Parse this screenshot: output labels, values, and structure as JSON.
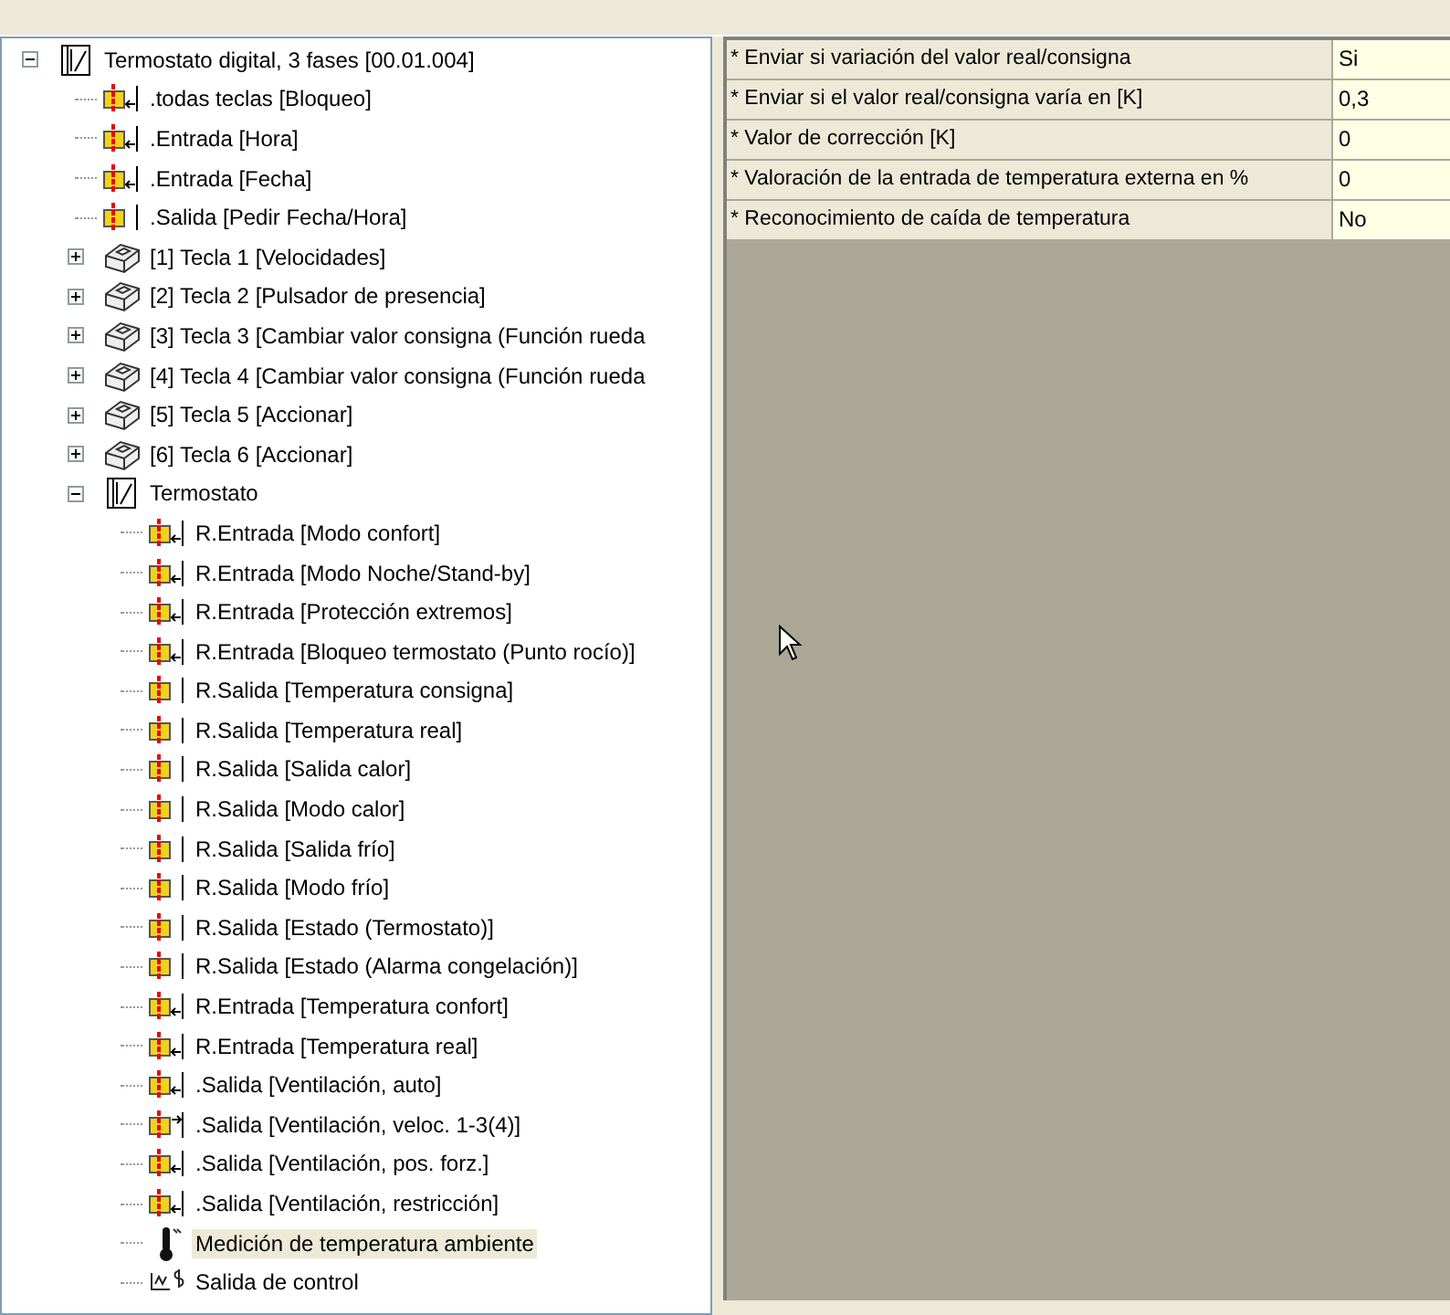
{
  "tree": [
    {
      "label": "Termostato digital, 3 fases [00.01.004]",
      "kind": "function-block",
      "expanded": true,
      "selected": false,
      "children": [
        {
          "label": ".todas teclas [Bloqueo]",
          "kind": "comm-in",
          "selected": false
        },
        {
          "label": ".Entrada [Hora]",
          "kind": "comm-in",
          "selected": false
        },
        {
          "label": ".Entrada [Fecha]",
          "kind": "comm-in",
          "selected": false
        },
        {
          "label": ".Salida [Pedir Fecha/Hora]",
          "kind": "comm-out",
          "selected": false
        },
        {
          "label": "[1] Tecla 1 [Velocidades]",
          "kind": "key-module",
          "expanded": false,
          "selected": false
        },
        {
          "label": "[2] Tecla 2 [Pulsador de presencia]",
          "kind": "key-module",
          "expanded": false,
          "selected": false
        },
        {
          "label": "[3] Tecla 3 [Cambiar valor consigna (Función rueda",
          "kind": "key-module",
          "expanded": false,
          "selected": false
        },
        {
          "label": "[4] Tecla 4 [Cambiar valor consigna (Función rueda",
          "kind": "key-module",
          "expanded": false,
          "selected": false
        },
        {
          "label": "[5] Tecla 5 [Accionar]",
          "kind": "key-module",
          "expanded": false,
          "selected": false
        },
        {
          "label": "[6] Tecla 6 [Accionar]",
          "kind": "key-module",
          "expanded": false,
          "selected": false
        },
        {
          "label": "Termostato",
          "kind": "function-block",
          "expanded": true,
          "selected": false,
          "children": [
            {
              "label": "R.Entrada [Modo confort]",
              "kind": "comm-in",
              "selected": false
            },
            {
              "label": "R.Entrada [Modo Noche/Stand-by]",
              "kind": "comm-in",
              "selected": false
            },
            {
              "label": "R.Entrada [Protección extremos]",
              "kind": "comm-in",
              "selected": false
            },
            {
              "label": "R.Entrada [Bloqueo termostato (Punto rocío)]",
              "kind": "comm-in",
              "selected": false
            },
            {
              "label": "R.Salida [Temperatura consigna]",
              "kind": "comm-out",
              "selected": false
            },
            {
              "label": "R.Salida [Temperatura real]",
              "kind": "comm-out",
              "selected": false
            },
            {
              "label": "R.Salida [Salida calor]",
              "kind": "comm-out",
              "selected": false
            },
            {
              "label": "R.Salida [Modo calor]",
              "kind": "comm-out",
              "selected": false
            },
            {
              "label": "R.Salida [Salida frío]",
              "kind": "comm-out",
              "selected": false
            },
            {
              "label": "R.Salida [Modo frío]",
              "kind": "comm-out",
              "selected": false
            },
            {
              "label": "R.Salida [Estado (Termostato)]",
              "kind": "comm-out",
              "selected": false
            },
            {
              "label": "R.Salida [Estado (Alarma congelación)]",
              "kind": "comm-out",
              "selected": false
            },
            {
              "label": "R.Entrada [Temperatura confort]",
              "kind": "comm-in",
              "selected": false
            },
            {
              "label": "R.Entrada [Temperatura real]",
              "kind": "comm-in",
              "selected": false
            },
            {
              "label": ".Salida [Ventilación, auto]",
              "kind": "comm-in",
              "selected": false
            },
            {
              "label": ".Salida [Ventilación, veloc. 1-3(4)]",
              "kind": "comm-send",
              "selected": false
            },
            {
              "label": ".Salida [Ventilación, pos. forz.]",
              "kind": "comm-in",
              "selected": false
            },
            {
              "label": ".Salida [Ventilación, restricción]",
              "kind": "comm-in",
              "selected": false
            },
            {
              "label": "Medición de temperatura ambiente",
              "kind": "sensor",
              "selected": true
            },
            {
              "label": "Salida de control",
              "kind": "control-output",
              "selected": false
            }
          ]
        }
      ]
    }
  ],
  "parameters": [
    {
      "label": "* Enviar si variación del valor real/consigna",
      "value": "Si"
    },
    {
      "label": "* Enviar si el valor real/consigna varía en [K]",
      "value": "0,3"
    },
    {
      "label": "* Valor de corrección [K]",
      "value": "0"
    },
    {
      "label": "* Valoración de la entrada de temperatura externa en %",
      "value": "0"
    },
    {
      "label": "* Reconocimiento de caída de temperatura",
      "value": "No"
    }
  ]
}
